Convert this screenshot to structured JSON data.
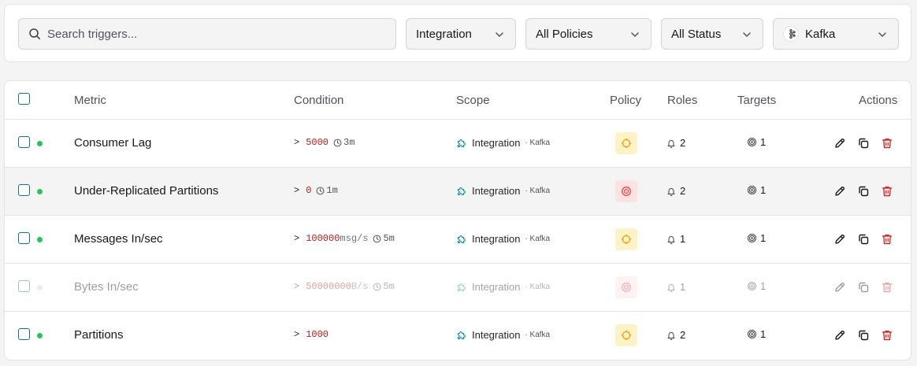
{
  "filters": {
    "search_placeholder": "Search triggers...",
    "scope_select": "Integration",
    "policy_select": "All Policies",
    "status_select": "All Status",
    "integration_select": "Kafka"
  },
  "table": {
    "headers": {
      "metric": "Metric",
      "condition": "Condition",
      "scope": "Scope",
      "policy": "Policy",
      "roles": "Roles",
      "targets": "Targets",
      "actions": "Actions"
    },
    "rows": [
      {
        "metric": "Consumer Lag",
        "op": ">",
        "value": "5000",
        "unit": "",
        "duration": "3m",
        "scope": "Integration",
        "scope_sub": "· Kafka",
        "policy": "warning",
        "roles": "2",
        "targets": "1",
        "status": "active"
      },
      {
        "metric": "Under-Replicated Partitions",
        "op": ">",
        "value": "0",
        "unit": "",
        "duration": "1m",
        "scope": "Integration",
        "scope_sub": "· Kafka",
        "policy": "critical",
        "roles": "2",
        "targets": "1",
        "status": "active"
      },
      {
        "metric": "Messages In/sec",
        "op": ">",
        "value": "100000",
        "unit": "msg/s",
        "duration": "5m",
        "scope": "Integration",
        "scope_sub": "· Kafka",
        "policy": "warning",
        "roles": "1",
        "targets": "1",
        "status": "active"
      },
      {
        "metric": "Bytes In/sec",
        "op": ">",
        "value": "50000000",
        "unit": "B/s",
        "duration": "5m",
        "scope": "Integration",
        "scope_sub": "· Kafka",
        "policy": "critical",
        "roles": "1",
        "targets": "1",
        "status": "disabled"
      },
      {
        "metric": "Partitions",
        "op": ">",
        "value": "1000",
        "unit": "",
        "duration": "",
        "scope": "Integration",
        "scope_sub": "· Kafka",
        "policy": "warning",
        "roles": "2",
        "targets": "1",
        "status": "active"
      }
    ]
  },
  "colors": {
    "accent": "#0e7490",
    "active_dot": "#22c55e",
    "inactive_dot": "#d4d4d8",
    "danger": "#dc2626",
    "warning_bg": "#fef3c7",
    "warning_fg": "#f59e0b",
    "critical_bg": "#fee2e2",
    "critical_fg": "#ef4444"
  },
  "icons": {
    "search": "search-icon",
    "chevron": "chevron-down-icon",
    "kafka": "kafka-icon",
    "scope": "puzzle-icon",
    "policy_warning": "crosshair-icon",
    "policy_critical": "target-icon",
    "roles": "bell-icon",
    "targets": "target-dot-icon",
    "edit": "pencil-icon",
    "duplicate": "copy-icon",
    "delete": "trash-icon",
    "duration": "clock-icon"
  }
}
